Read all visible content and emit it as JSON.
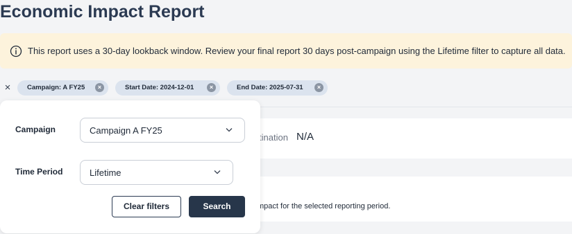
{
  "page": {
    "title": "Economic Impact Report"
  },
  "banner": {
    "icon": "info-icon",
    "message": "This report uses a 30-day lookback window. Review your final report 30 days post-campaign using the Lifetime filter to capture all data."
  },
  "chips": {
    "clear_all_glyph": "×",
    "remove_glyph": "×",
    "items": [
      {
        "label": "Campaign: A FY25"
      },
      {
        "label": "Start Date: 2024-12-01"
      },
      {
        "label": "End Date: 2025-07-31"
      }
    ]
  },
  "summary": {
    "destination_label_partial": "tination",
    "destination_value": "N/A",
    "description_partial": "mpact for the selected reporting period."
  },
  "filters": {
    "campaign": {
      "label": "Campaign",
      "selected": "Campaign A FY25"
    },
    "time_period": {
      "label": "Time Period",
      "selected": "Lifetime"
    },
    "clear_label": "Clear filters",
    "search_label": "Search"
  },
  "colors": {
    "banner_bg": "#fdf3dc",
    "chip_bg": "#dbe3ee",
    "primary_button": "#27364a",
    "title": "#2b3a52"
  }
}
